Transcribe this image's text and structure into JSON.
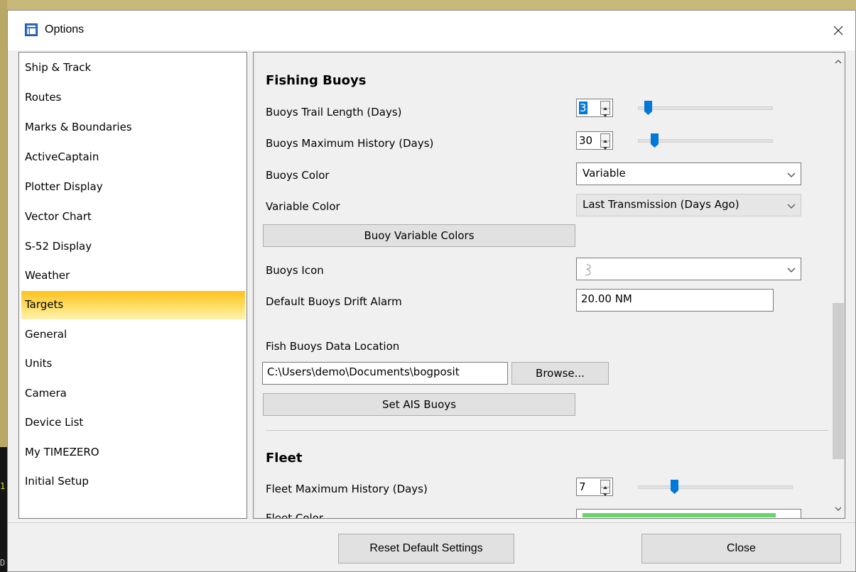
{
  "window": {
    "title": "Options",
    "close_icon": "close-icon",
    "app_icon": "options-app-icon"
  },
  "sidebar": {
    "items": [
      {
        "label": "Ship & Track"
      },
      {
        "label": "Routes"
      },
      {
        "label": "Marks & Boundaries"
      },
      {
        "label": "ActiveCaptain"
      },
      {
        "label": "Plotter Display"
      },
      {
        "label": "Vector Chart"
      },
      {
        "label": "S-52 Display"
      },
      {
        "label": "Weather"
      },
      {
        "label": "Targets",
        "selected": true
      },
      {
        "label": "General"
      },
      {
        "label": "Units"
      },
      {
        "label": "Camera"
      },
      {
        "label": "Device List"
      },
      {
        "label": "My TIMEZERO"
      },
      {
        "label": "Initial Setup"
      }
    ]
  },
  "fishing_buoys": {
    "section_title": "Fishing Buoys",
    "trail_length": {
      "label": "Buoys Trail Length (Days)",
      "value": "3",
      "slider_fraction": 0.05
    },
    "max_history": {
      "label": "Buoys Maximum History (Days)",
      "value": "30",
      "slider_fraction": 0.1
    },
    "buoys_color": {
      "label": "Buoys Color",
      "value": "Variable"
    },
    "variable_color": {
      "label": "Variable Color",
      "value": "Last Transmission (Days Ago)"
    },
    "buoy_variable_colors_button": "Buoy Variable Colors",
    "buoys_icon": {
      "label": "Buoys Icon",
      "icon": "buoy-icon"
    },
    "drift_alarm": {
      "label": "Default Buoys Drift Alarm",
      "value": "20.00 NM"
    },
    "data_location": {
      "label": "Fish Buoys Data Location",
      "value": "C:\\Users\\demo\\Documents\\bogposit",
      "browse_label": "Browse..."
    },
    "set_ais_buoys_button": "Set AIS Buoys"
  },
  "fleet": {
    "section_title": "Fleet",
    "max_history": {
      "label": "Fleet Maximum History (Days)",
      "value": "7",
      "slider_fraction": 0.22
    },
    "fleet_color_partial_label": "Fleet Color",
    "fleet_color_swatch": "#6bd36b"
  },
  "footer": {
    "reset_label": "Reset Default Settings",
    "close_label": "Close"
  },
  "desktop": {
    "left_glyphs": [
      "1",
      "D"
    ]
  },
  "colors": {
    "accent": "#0078d7",
    "selection": "#ffc21d"
  }
}
